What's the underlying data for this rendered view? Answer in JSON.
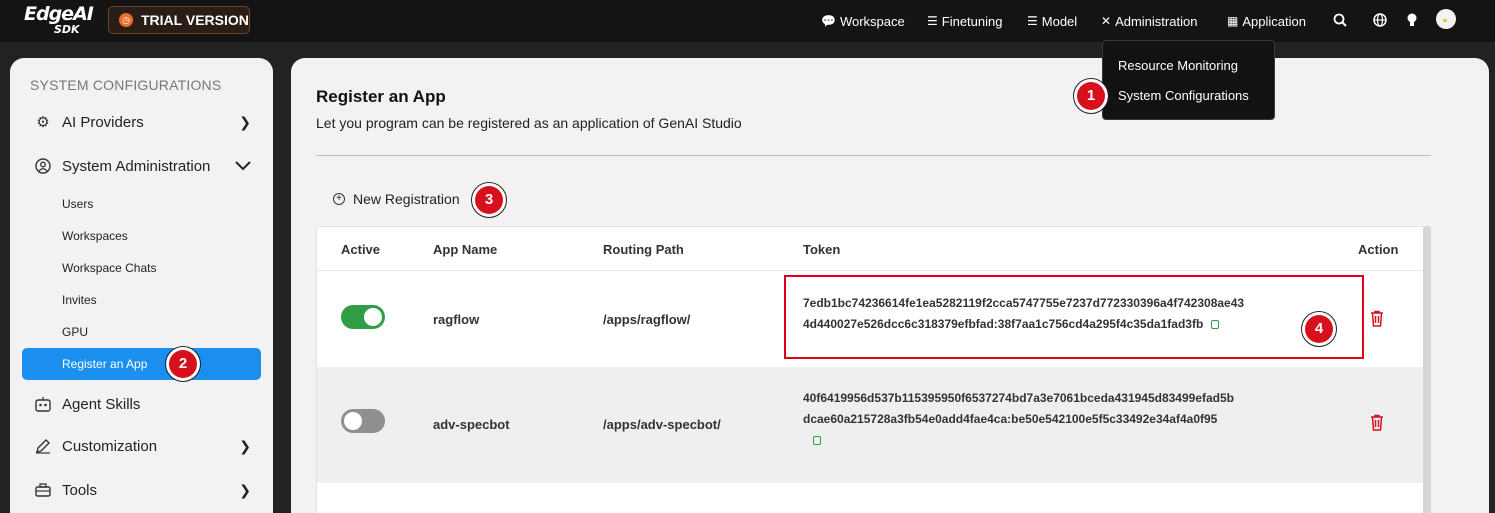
{
  "app": {
    "logo_line1": "EdgeAI",
    "logo_line2": "SDK",
    "trial_label": "TRIAL VERSION"
  },
  "nav": {
    "workspace": "Workspace",
    "finetuning": "Finetuning",
    "model": "Model",
    "administration": "Administration",
    "application": "Application"
  },
  "dropdown": {
    "items": [
      "Resource Monitoring",
      "System Configurations"
    ]
  },
  "sidebar": {
    "heading": "SYSTEM CONFIGURATIONS",
    "ai_providers": "AI Providers",
    "system_administration": "System Administration",
    "sub_items": [
      "Users",
      "Workspaces",
      "Workspace Chats",
      "Invites",
      "GPU",
      "Register an App"
    ],
    "agent_skills": "Agent Skills",
    "customization": "Customization",
    "tools": "Tools"
  },
  "main": {
    "title": "Register an App",
    "subtitle": "Let you program can be registered as an application of GenAI Studio",
    "new_registration": "New Registration"
  },
  "table": {
    "headers": [
      "Active",
      "App Name",
      "Routing Path",
      "Token",
      "Action"
    ],
    "rows": [
      {
        "active": true,
        "app_name": "ragflow",
        "routing_path": "/apps/ragflow/",
        "token_line1": "7edb1bc74236614fe1ea5282119f2cca5747755e7237d772330396a4f742308ae43",
        "token_line2": "4d440027e526dcc6c318379efbfad:38f7aa1c756cd4a295f4c35da1fad3fb"
      },
      {
        "active": false,
        "app_name": "adv-specbot",
        "routing_path": "/apps/adv-specbot/",
        "token_line1": "40f6419956d537b115395950f6537274bd7a3e7061bceda431945d83499efad5b",
        "token_line2": "dcae60a215728a3fb54e0add4fae4ca:be50e542100e5f5c33492e34af4a0f95"
      }
    ]
  },
  "badges": [
    "1",
    "2",
    "3",
    "4"
  ],
  "colors": {
    "accent": "#1a8ff0",
    "toggle_on": "#2f9e44",
    "highlight": "#e0001b",
    "badge": "#d6111b"
  }
}
